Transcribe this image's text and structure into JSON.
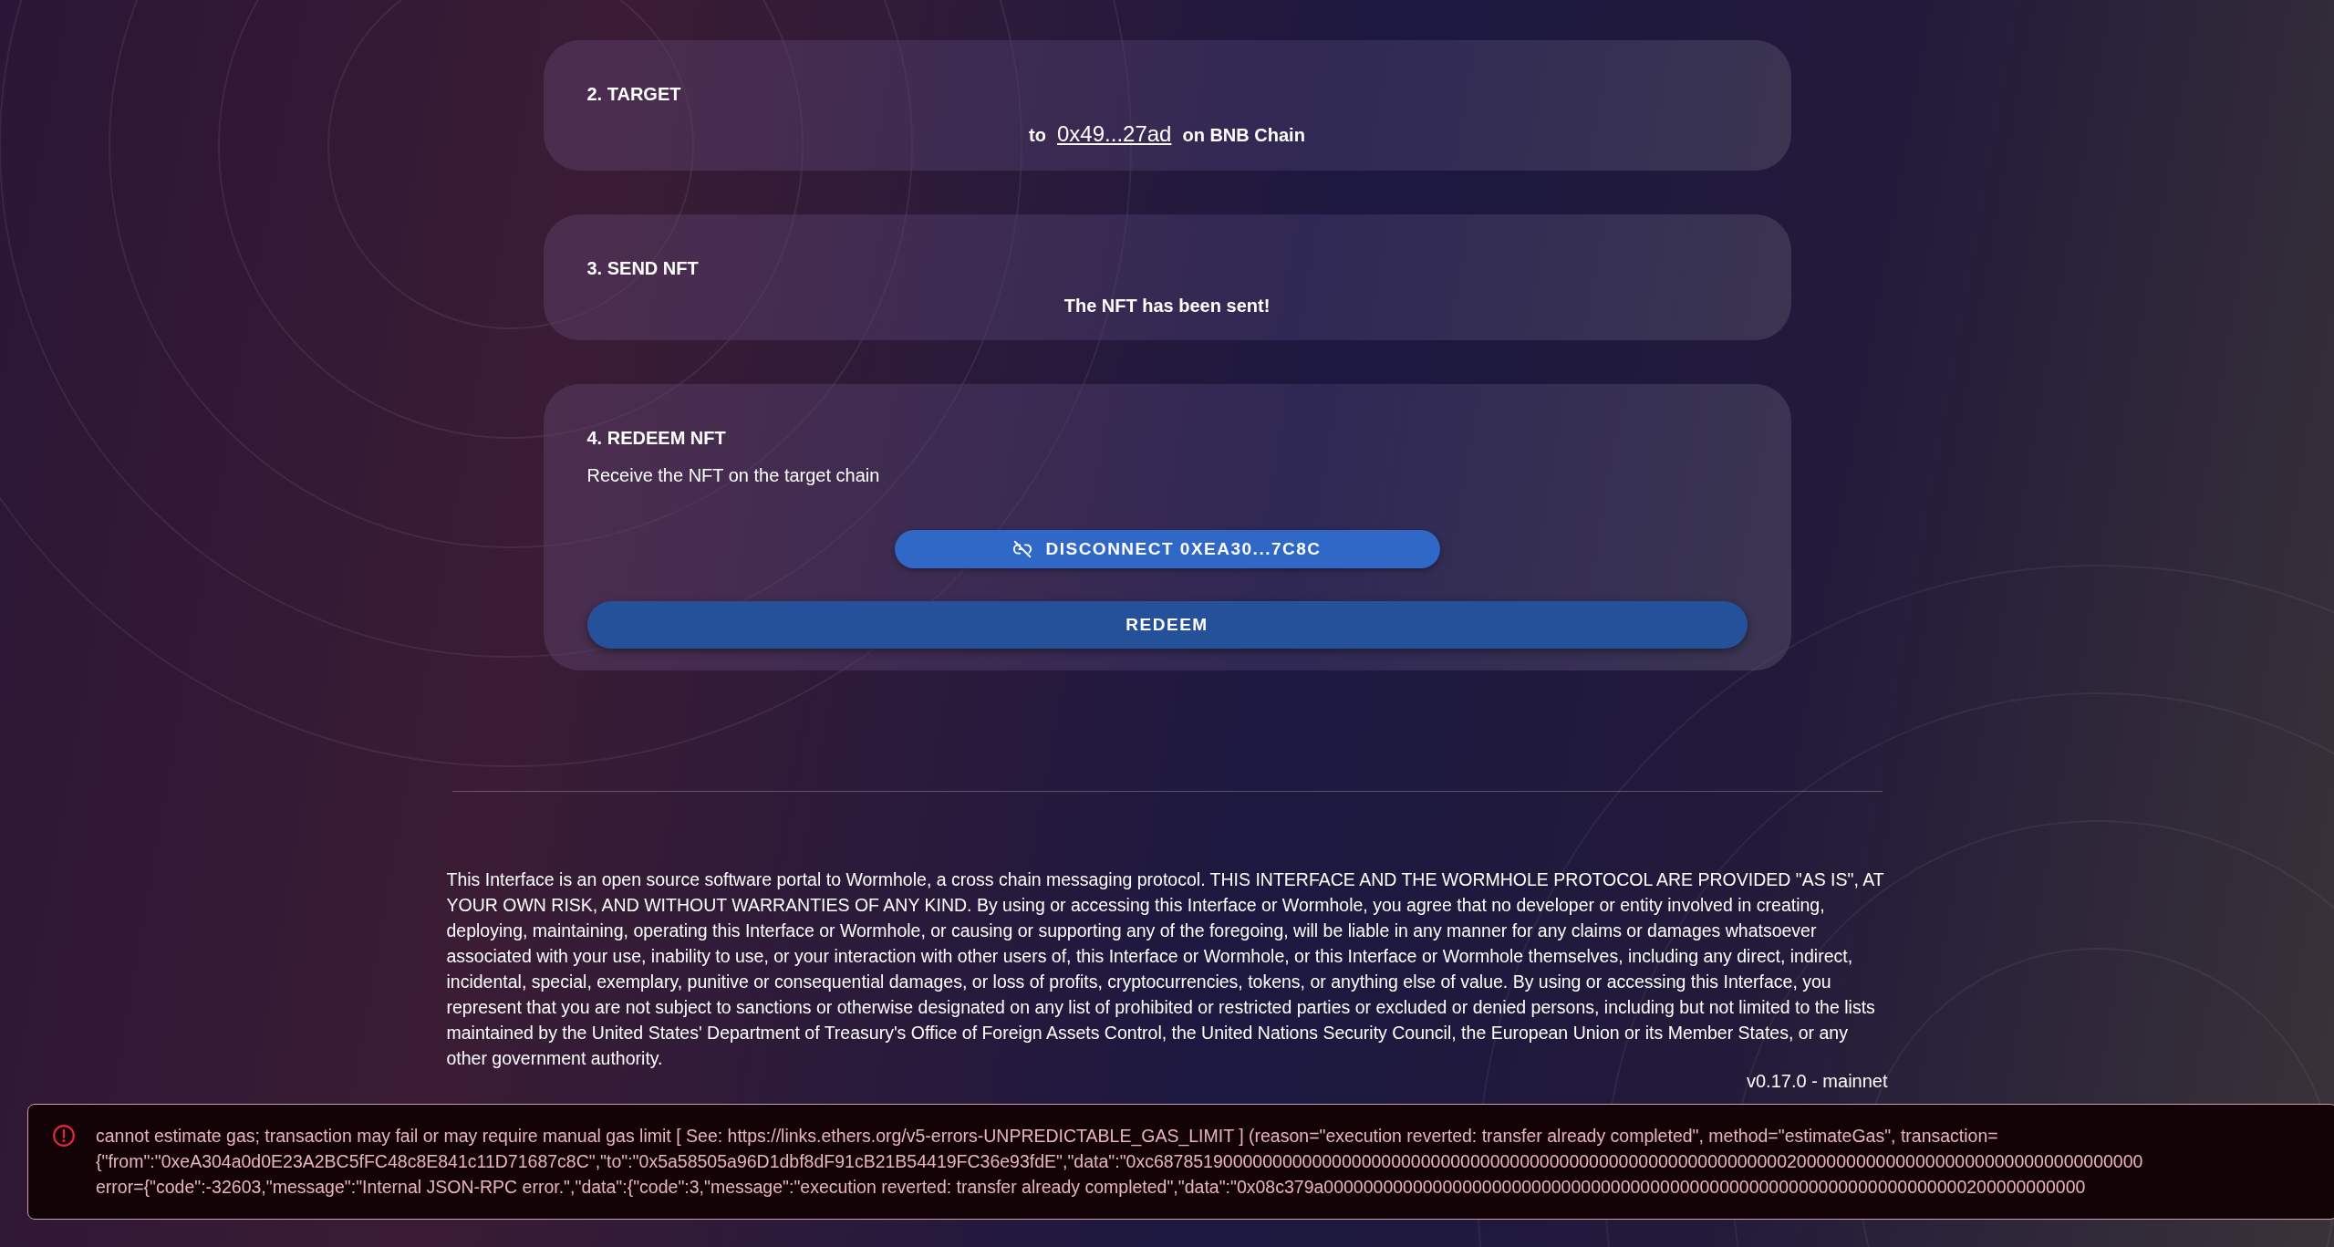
{
  "steps": [
    {
      "kind": "target",
      "title": "2. TARGET",
      "prefix": "to",
      "address": "0x49...27ad",
      "suffix": "on BNB Chain"
    },
    {
      "kind": "sent",
      "title": "3. SEND NFT",
      "message": "The NFT has been sent!"
    },
    {
      "kind": "redeem",
      "title": "4. REDEEM NFT",
      "description": "Receive the NFT on the target chain",
      "disconnect_button": "DISCONNECT 0XEA30...7C8C",
      "redeem_button": "REDEEM"
    }
  ],
  "disclaimer": "This Interface is an open source software portal to Wormhole, a cross chain messaging protocol. THIS INTERFACE AND THE WORMHOLE PROTOCOL ARE PROVIDED \"AS IS\", AT YOUR OWN RISK, AND WITHOUT WARRANTIES OF ANY KIND. By using or accessing this Interface or Wormhole, you agree that no developer or entity involved in creating, deploying, maintaining, operating this Interface or Wormhole, or causing or supporting any of the foregoing, will be liable in any manner for any claims or damages whatsoever associated with your use, inability to use, or your interaction with other users of, this Interface or Wormhole, or this Interface or Wormhole themselves, including any direct, indirect, incidental, special, exemplary, punitive or consequential damages, or loss of profits, cryptocurrencies, tokens, or anything else of value. By using or accessing this Interface, you represent that you are not subject to sanctions or otherwise designated on any list of prohibited or restricted parties or excluded or denied persons, including but not limited to the lists maintained by the United States' Department of Treasury's Office of Foreign Assets Control, the United Nations Security Council, the European Union or its Member States, or any other government authority.",
  "version": "v0.17.0 - mainnet",
  "error_toast": {
    "lines": [
      "cannot estimate gas; transaction may fail or may require manual gas limit [ See: https://links.ethers.org/v5-errors-UNPREDICTABLE_GAS_LIMIT ] (reason=\"execution reverted: transfer already completed\", method=\"estimateGas\", transaction=",
      "{\"from\":\"0xeA304a0d0E23A2BC5fFC48c8E841c11D71687c8C\",\"to\":\"0x5a58505a96D1dbf8dF91cB21B54419FC36e93fdE\",\"data\":\"0xc6878519000000000000000000000000000000000000000000000000000000000200000000000000000000000000000000000",
      "error={\"code\":-32603,\"message\":\"Internal JSON-RPC error.\",\"data\":{\"code\":3,\"message\":\"execution reverted: transfer already completed\",\"data\":\"0x08c379a00000000000000000000000000000000000000000000000000000000000000000200000000000"
    ]
  }
}
